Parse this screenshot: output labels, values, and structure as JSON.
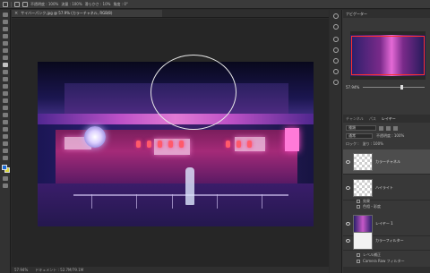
{
  "options_bar": {
    "items": [
      "不透明度 : 100%",
      "流量 : 100%",
      "滑らかさ : 10%",
      "角度 : 0°"
    ]
  },
  "document": {
    "tab_title": "サイバーパンク.jpg @ 57.9% (カラーチャネル, RGB/8)",
    "close_glyph": "×"
  },
  "navigator": {
    "title": "ナビゲーター",
    "zoom": "57.94%"
  },
  "layers_panel": {
    "tabs": [
      "チャンネル",
      "パス",
      "レイヤー"
    ],
    "active_tab": "レイヤー",
    "filter_label": "種類",
    "blend_mode": "通常",
    "opacity_label": "不透明度 : 100%",
    "fill_label": "塗り : 100%",
    "lock_label": "ロック :",
    "layers": [
      {
        "name": "カラーチャネル",
        "thumb": "checker",
        "selected": true
      },
      {
        "name": "ハイライト",
        "thumb": "checker",
        "selected": false
      },
      {
        "name": "レイヤー 1",
        "thumb": "photo",
        "selected": false
      },
      {
        "name": "カラーフィルター",
        "thumb": "white",
        "selected": false
      }
    ],
    "sublayers_1": [
      "効果",
      "色相・彩度"
    ],
    "sublayers_3": [
      "レベル補正",
      "Camera Raw フィルター"
    ]
  },
  "status": {
    "zoom": "57.94%",
    "doc_size": "ドキュメント : 52.7M/79.1M"
  },
  "colors": {
    "foreground": "#1a6bd6",
    "background": "#d6d63a",
    "accent_selection": "#ff3030"
  }
}
